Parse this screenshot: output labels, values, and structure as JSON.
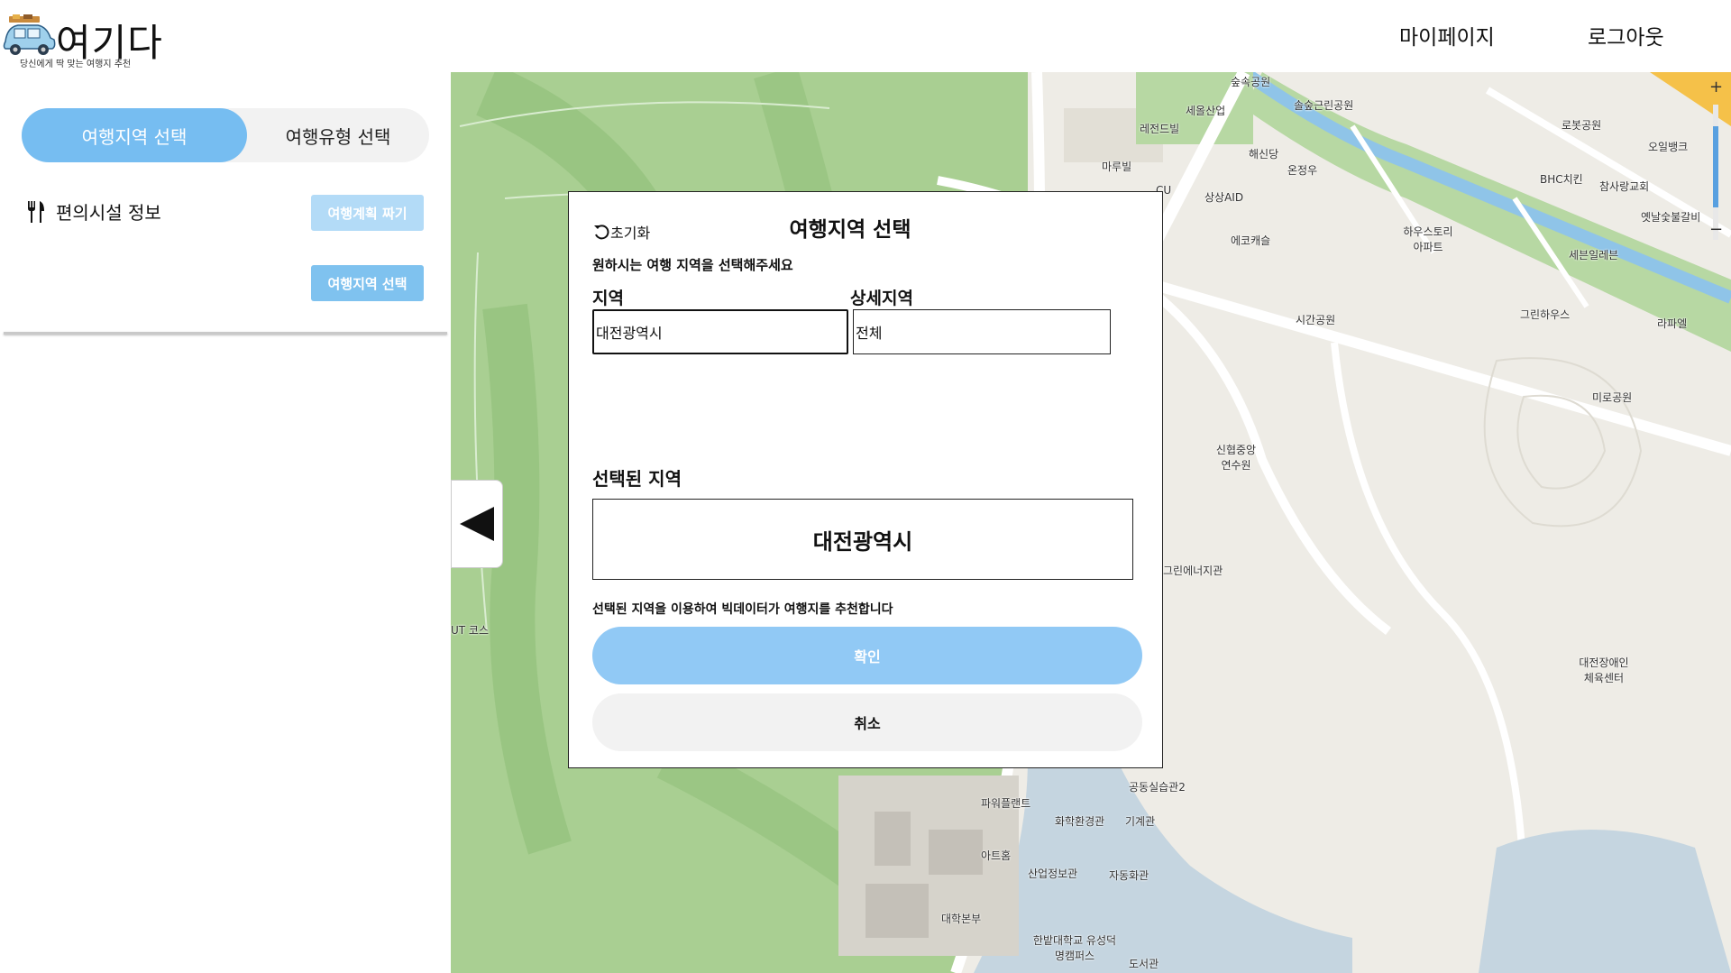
{
  "app": {
    "title": "여기다",
    "subtitle": "당신에게 딱 맞는 여행지 추천"
  },
  "nav": {
    "mypage": "마이페이지",
    "logout": "로그아웃"
  },
  "sidebar": {
    "tabs": [
      "여행지역 선택",
      "여행유형 선택"
    ],
    "facility_label": "편의시설 정보",
    "plan_button": "여행계획 짜기",
    "region_button": "여행지역 선택"
  },
  "map": {
    "labels": [
      "숲속공원",
      "솔숲근린공원",
      "로봇공원",
      "오일뱅크",
      "세올산업",
      "레전드빌",
      "해신당",
      "온정우",
      "마루빌",
      "BHC치킨",
      "참사랑교회",
      "옛날숯불갈비",
      "상상AID",
      "CU",
      "에코캐슬",
      "하우스토리 아파트",
      "세븐일레븐",
      "시간공원",
      "그린하우스",
      "라파엘",
      "미로공원",
      "신협중앙 연수원",
      "그린에너지관",
      "대전장애인 체육센터",
      "공동실습관2",
      "파워플랜트",
      "화학환경관",
      "기계관",
      "아트홈",
      "산업정보관",
      "자동화관",
      "대학본부",
      "한밭대학교 유성덕명캠퍼스",
      "도서관",
      "UT 코스"
    ],
    "accent_green": "#b7d8a3",
    "road_color": "#ffffff"
  },
  "modal": {
    "reset": "초기화",
    "title": "여행지역 선택",
    "description": "원하시는 여행 지역을 선택해주세요",
    "region_label": "지역",
    "region_value": "대전광역시",
    "detail_label": "상세지역",
    "detail_value": "전체",
    "selected_label": "선택된 지역",
    "selected_value": "대전광역시",
    "info": "선택된 지역을 이용하여 빅데이터가 여행지를 추천합니다",
    "confirm": "확인",
    "cancel": "취소"
  },
  "colors": {
    "primary": "#76bdf1",
    "primary_light": "#91c9f5"
  }
}
